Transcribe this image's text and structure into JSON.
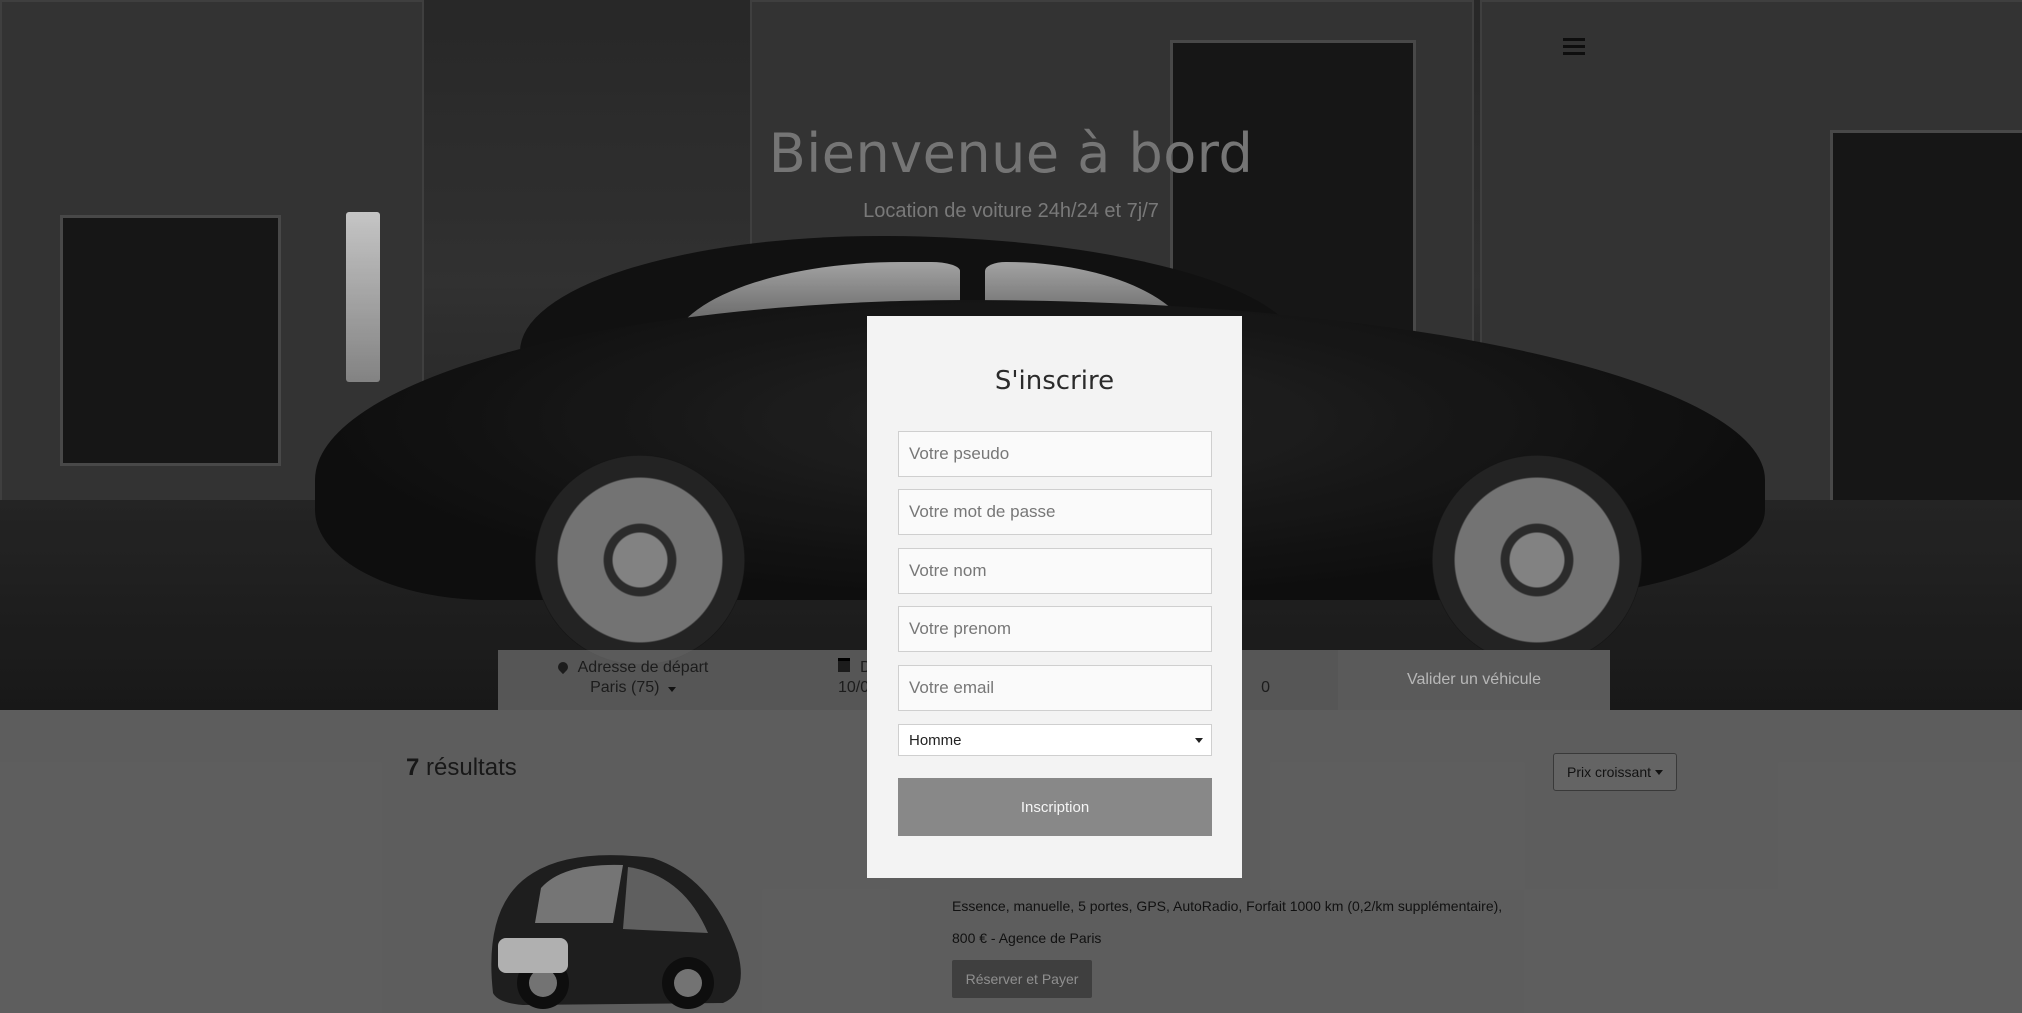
{
  "hero": {
    "title": "Bienvenue à bord",
    "subtitle": "Location de voiture 24h/24 et 7j/7"
  },
  "search_bar": {
    "departure_label": "Adresse de départ",
    "departure_value": "Paris (75)",
    "date_label": "D",
    "date_value": "10/0",
    "time_value": "0",
    "validate_label": "Valider un véhicule"
  },
  "results": {
    "count": "7",
    "label": "résultats",
    "sort_label": "Prix croissant"
  },
  "car": {
    "description": "Essence, manuelle, 5 portes, GPS, AutoRadio, Forfait 1000 km (0,2/km supplémentaire),",
    "price": "800 € - Agence de Paris",
    "reserve_label": "Réserver et Payer"
  },
  "modal": {
    "title": "S'inscrire",
    "pseudo_placeholder": "Votre pseudo",
    "password_placeholder": "Votre mot de passe",
    "nom_placeholder": "Votre nom",
    "prenom_placeholder": "Votre prenom",
    "email_placeholder": "Votre email",
    "gender_value": "Homme",
    "submit_label": "Inscription"
  }
}
